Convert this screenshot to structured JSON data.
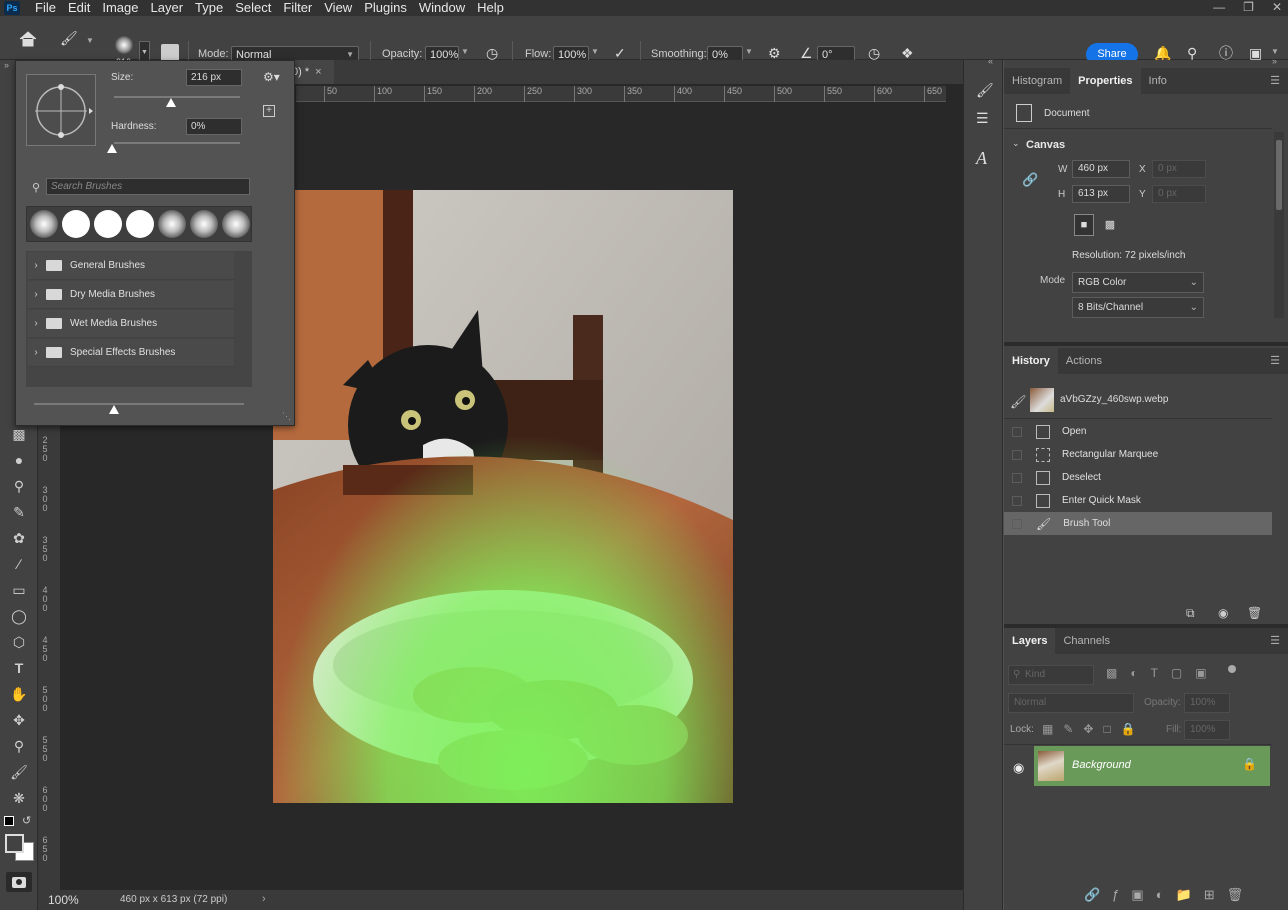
{
  "menubar": {
    "logo": "Ps",
    "items": [
      "File",
      "Edit",
      "Image",
      "Layer",
      "Type",
      "Select",
      "Filter",
      "View",
      "Plugins",
      "Window",
      "Help"
    ]
  },
  "options": {
    "brush_size": "216",
    "mode_label": "Mode:",
    "mode_value": "Normal",
    "opacity_label": "Opacity:",
    "opacity_value": "100%",
    "flow_label": "Flow:",
    "flow_value": "100%",
    "smoothing_label": "Smoothing:",
    "smoothing_value": "0%",
    "angle_value": "0°",
    "share_label": "Share"
  },
  "document": {
    "tab_label": "0) *",
    "ruler_h": [
      "50",
      "100",
      "150",
      "200",
      "250",
      "300",
      "350",
      "400",
      "450",
      "500",
      "550",
      "600",
      "650"
    ],
    "ruler_v": [
      "2",
      "5",
      "0",
      "3",
      "0",
      "0",
      "3",
      "5",
      "0",
      "4",
      "0",
      "0",
      "4",
      "5",
      "0",
      "5",
      "0",
      "0",
      "5",
      "5",
      "0",
      "6",
      "0",
      "0",
      "6",
      "5",
      "0"
    ],
    "zoom": "100%",
    "status": "460 px x 613 px (72 ppi)"
  },
  "brush_popup": {
    "size_label": "Size:",
    "size_value": "216 px",
    "size_fraction": 0.45,
    "hardness_label": "Hardness:",
    "hardness_value": "0%",
    "search_placeholder": "Search Brushes",
    "folders": [
      "General Brushes",
      "Dry Media Brushes",
      "Wet Media Brushes",
      "Special Effects Brushes"
    ]
  },
  "properties": {
    "tabs": [
      "Histogram",
      "Properties",
      "Info"
    ],
    "doc_label": "Document",
    "canvas_label": "Canvas",
    "w_label": "W",
    "w_value": "460 px",
    "h_label": "H",
    "h_value": "613 px",
    "x_label": "X",
    "x_placeholder": "0 px",
    "y_label": "Y",
    "y_placeholder": "0 px",
    "resolution": "Resolution: 72 pixels/inch",
    "mode_label": "Mode",
    "mode_value": "RGB Color",
    "bits_value": "8 Bits/Channel"
  },
  "history": {
    "tabs": [
      "History",
      "Actions"
    ],
    "snapshot": "aVbGZzy_460swp.webp",
    "steps": [
      "Open",
      "Rectangular Marquee",
      "Deselect",
      "Enter Quick Mask",
      "Brush Tool"
    ],
    "active_step": "Brush Tool"
  },
  "layers": {
    "tabs": [
      "Layers",
      "Channels"
    ],
    "filter_kind": "Kind",
    "blend_mode": "Normal",
    "opacity_label": "Opacity:",
    "opacity_value": "100%",
    "lock_label": "Lock:",
    "fill_label": "Fill:",
    "fill_value": "100%",
    "layer_name": "Background"
  },
  "colors": {
    "accent": "#1473e6",
    "layer_selected": "#6a9a5a",
    "mask_green": "#7cf25a"
  }
}
